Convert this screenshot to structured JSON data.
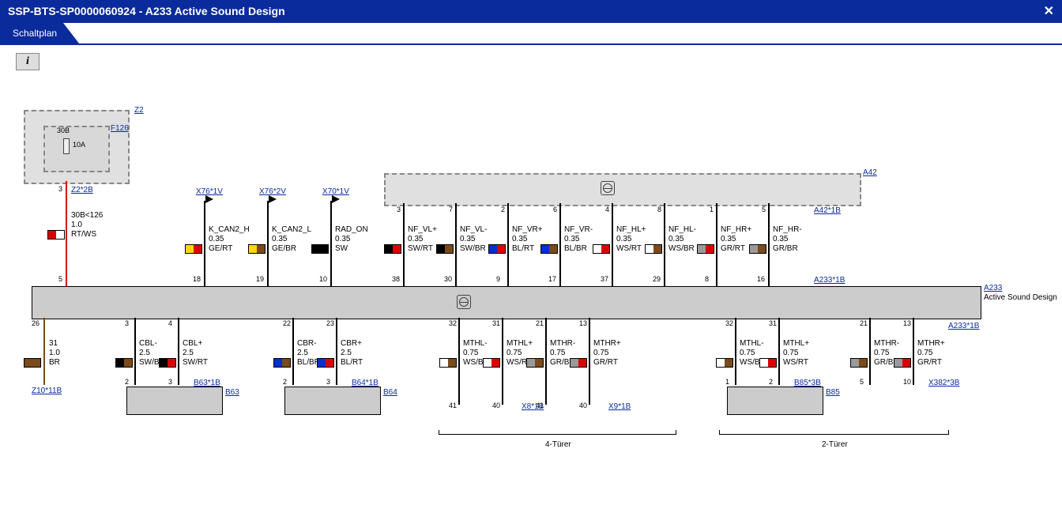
{
  "header": {
    "title": "SSP-BTS-SP0000060924  -  A233 Active Sound Design",
    "close": "✕"
  },
  "tab": {
    "label": "Schaltplan"
  },
  "info_button": "i",
  "refs": {
    "Z2": "Z2",
    "F126": "F126",
    "Z2_2B": "Z2*2B",
    "X76_1V": "X76*1V",
    "X76_2V": "X76*2V",
    "X70_1V": "X70*1V",
    "A42": "A42",
    "A42_1B": "A42*1B",
    "A233_1B_top": "A233*1B",
    "A233": "A233",
    "A233_sub": "Active Sound Design",
    "A233_1B_bot": "A233*1B",
    "Z10_11B": "Z10*11B",
    "B63_1B": "B63*1B",
    "B63": "B63",
    "B64_1B": "B64*1B",
    "B64": "B64",
    "X8_1B": "X8*1B",
    "X9_1B": "X9*1B",
    "B85_3B": "B85*3B",
    "B85": "B85",
    "X382_3B": "X382*3B"
  },
  "pins_top": {
    "Z2_bot": "3",
    "A233_left": "5",
    "X76_1V_bot": "18",
    "X76_2V_bot": "19",
    "X70_1V_bot": "10",
    "A42_p": [
      "3",
      "7",
      "2",
      "6",
      "4",
      "8",
      "1",
      "5"
    ],
    "A233_top_under_A42": [
      "38",
      "30",
      "9",
      "17",
      "37",
      "29",
      "8",
      "16"
    ]
  },
  "pins_bot": {
    "p26": "26",
    "b63_p": [
      "3",
      "4"
    ],
    "b63_b": [
      "2",
      "3"
    ],
    "b64_p": [
      "22",
      "23"
    ],
    "b64_b": [
      "2",
      "3"
    ],
    "g4_p": [
      "32",
      "31",
      "21",
      "13"
    ],
    "g4_b": [
      "41",
      "40",
      "41",
      "40"
    ],
    "g2_p": [
      "32",
      "31",
      "21",
      "13"
    ],
    "g2_b": [
      "1",
      "2",
      "5",
      "10"
    ]
  },
  "wires": {
    "w30B": {
      "sig": "30B<126",
      "gauge": "1.0",
      "col": "RT/WS"
    },
    "kcanh": {
      "sig": "K_CAN2_H",
      "gauge": "0.35",
      "col": "GE/RT"
    },
    "kcanl": {
      "sig": "K_CAN2_L",
      "gauge": "0.35",
      "col": "GE/BR"
    },
    "radon": {
      "sig": "RAD_ON",
      "gauge": "0.35",
      "col": "SW"
    },
    "nfvlp": {
      "sig": "NF_VL+",
      "gauge": "0.35",
      "col": "SW/RT"
    },
    "nfvlm": {
      "sig": "NF_VL-",
      "gauge": "0.35",
      "col": "SW/BR"
    },
    "nfvrp": {
      "sig": "NF_VR+",
      "gauge": "0.35",
      "col": "BL/RT"
    },
    "nfvrm": {
      "sig": "NF_VR-",
      "gauge": "0.35",
      "col": "BL/BR"
    },
    "nfhlp": {
      "sig": "NF_HL+",
      "gauge": "0.35",
      "col": "WS/RT"
    },
    "nfhlm": {
      "sig": "NF_HL-",
      "gauge": "0.35",
      "col": "WS/BR"
    },
    "nfhrp": {
      "sig": "NF_HR+",
      "gauge": "0.35",
      "col": "GR/RT"
    },
    "nfhrm": {
      "sig": "NF_HR-",
      "gauge": "0.35",
      "col": "GR/BR"
    },
    "w31": {
      "sig": "31",
      "gauge": "1.0",
      "col": "BR"
    },
    "cblm": {
      "sig": "CBL-",
      "gauge": "2.5",
      "col": "SW/BR"
    },
    "cblp": {
      "sig": "CBL+",
      "gauge": "2.5",
      "col": "SW/RT"
    },
    "cbrm": {
      "sig": "CBR-",
      "gauge": "2.5",
      "col": "BL/BR"
    },
    "cbrp": {
      "sig": "CBR+",
      "gauge": "2.5",
      "col": "BL/RT"
    },
    "mthlm4": {
      "sig": "MTHL-",
      "gauge": "0.75",
      "col": "WS/BR"
    },
    "mthlp4": {
      "sig": "MTHL+",
      "gauge": "0.75",
      "col": "WS/RT"
    },
    "mthrm4": {
      "sig": "MTHR-",
      "gauge": "0.75",
      "col": "GR/BR"
    },
    "mthrp4": {
      "sig": "MTHR+",
      "gauge": "0.75",
      "col": "GR/RT"
    },
    "mthlm2": {
      "sig": "MTHL-",
      "gauge": "0.75",
      "col": "WS/BR"
    },
    "mthlp2": {
      "sig": "MTHL+",
      "gauge": "0.75",
      "col": "WS/RT"
    },
    "mthrm2": {
      "sig": "MTHR-",
      "gauge": "0.75",
      "col": "GR/BR"
    },
    "mthrp2": {
      "sig": "MTHR+",
      "gauge": "0.75",
      "col": "GR/RT"
    }
  },
  "fuse": {
    "lbl": "30B",
    "amp": "10A"
  },
  "groups": {
    "g4": "4-Türer",
    "g2": "2-Türer"
  },
  "colors": {
    "RT": "#d00",
    "WS": "#fff",
    "GE": "#ffd800",
    "BR": "#7a4a1a",
    "SW": "#000",
    "BL": "#0030d0",
    "GR": "#9a9a9a"
  }
}
